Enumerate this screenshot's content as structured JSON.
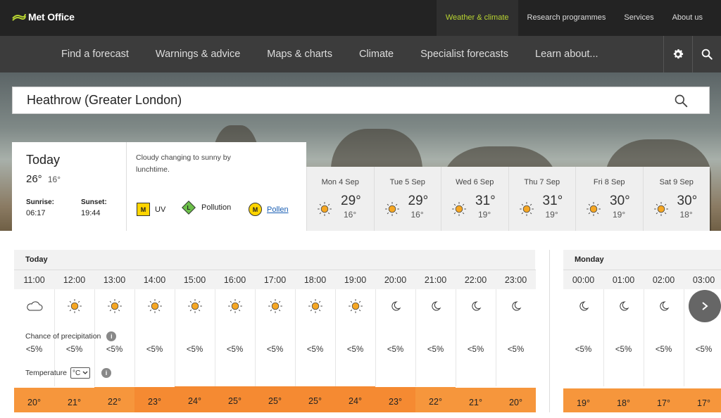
{
  "header": {
    "logo": "Met Office",
    "top_links": [
      {
        "label": "Weather & climate",
        "active": true
      },
      {
        "label": "Research programmes"
      },
      {
        "label": "Services"
      },
      {
        "label": "About us"
      }
    ]
  },
  "nav": {
    "items": [
      "Find a forecast",
      "Warnings & advice",
      "Maps & charts",
      "Climate",
      "Specialist forecasts",
      "Learn about..."
    ]
  },
  "search": {
    "value": "Heathrow (Greater London)"
  },
  "today": {
    "title": "Today",
    "high": "26°",
    "low": "16°",
    "sunrise_label": "Sunrise:",
    "sunrise": "06:17",
    "sunset_label": "Sunset:",
    "sunset": "19:44",
    "description": "Cloudy changing to sunny by lunchtime.",
    "uv": {
      "badge": "M",
      "label": "UV"
    },
    "pollution": {
      "badge": "L",
      "label": "Pollution"
    },
    "pollen": {
      "badge": "M",
      "label": "Pollen"
    }
  },
  "days": [
    {
      "name": "Mon 4 Sep",
      "high": "29°",
      "low": "16°",
      "icon": "sun-icon"
    },
    {
      "name": "Tue 5 Sep",
      "high": "29°",
      "low": "16°",
      "icon": "sun-icon"
    },
    {
      "name": "Wed 6 Sep",
      "high": "31°",
      "low": "19°",
      "icon": "sun-icon"
    },
    {
      "name": "Thu 7 Sep",
      "high": "31°",
      "low": "19°",
      "icon": "sun-icon"
    },
    {
      "name": "Fri 8 Sep",
      "high": "30°",
      "low": "19°",
      "icon": "sun-icon"
    },
    {
      "name": "Sat 9 Sep",
      "high": "30°",
      "low": "18°",
      "icon": "sun-icon"
    }
  ],
  "hourly": {
    "today_label": "Today",
    "monday_label": "Monday",
    "precip_label": "Chance of precipitation",
    "temp_label": "Temperature",
    "temp_unit": "°C",
    "today_hours": [
      {
        "time": "11:00",
        "icon": "cloud-icon",
        "precip": "<5%",
        "temp": "20°"
      },
      {
        "time": "12:00",
        "icon": "sun-icon",
        "precip": "<5%",
        "temp": "21°"
      },
      {
        "time": "13:00",
        "icon": "sun-icon",
        "precip": "<5%",
        "temp": "22°"
      },
      {
        "time": "14:00",
        "icon": "sun-icon",
        "precip": "<5%",
        "temp": "23°"
      },
      {
        "time": "15:00",
        "icon": "sun-icon",
        "precip": "<5%",
        "temp": "24°"
      },
      {
        "time": "16:00",
        "icon": "sun-icon",
        "precip": "<5%",
        "temp": "25°"
      },
      {
        "time": "17:00",
        "icon": "sun-icon",
        "precip": "<5%",
        "temp": "25°"
      },
      {
        "time": "18:00",
        "icon": "sun-icon",
        "precip": "<5%",
        "temp": "25°"
      },
      {
        "time": "19:00",
        "icon": "sun-icon",
        "precip": "<5%",
        "temp": "24°"
      },
      {
        "time": "20:00",
        "icon": "moon-icon",
        "precip": "<5%",
        "temp": "23°"
      },
      {
        "time": "21:00",
        "icon": "moon-icon",
        "precip": "<5%",
        "temp": "22°"
      },
      {
        "time": "22:00",
        "icon": "moon-icon",
        "precip": "<5%",
        "temp": "21°"
      },
      {
        "time": "23:00",
        "icon": "moon-icon",
        "precip": "<5%",
        "temp": "20°"
      }
    ],
    "monday_hours": [
      {
        "time": "00:00",
        "icon": "moon-icon",
        "precip": "<5%",
        "temp": "19°"
      },
      {
        "time": "01:00",
        "icon": "moon-icon",
        "precip": "<5%",
        "temp": "18°"
      },
      {
        "time": "02:00",
        "icon": "moon-icon",
        "precip": "<5%",
        "temp": "17°"
      },
      {
        "time": "03:00",
        "icon": "moon-icon",
        "precip": "<5%",
        "temp": "17°"
      }
    ]
  },
  "colors": {
    "accent": "#b8d432",
    "temp_warm": "#f6963c",
    "temp_hot": "#f58a32",
    "sun": "#f5a623"
  }
}
